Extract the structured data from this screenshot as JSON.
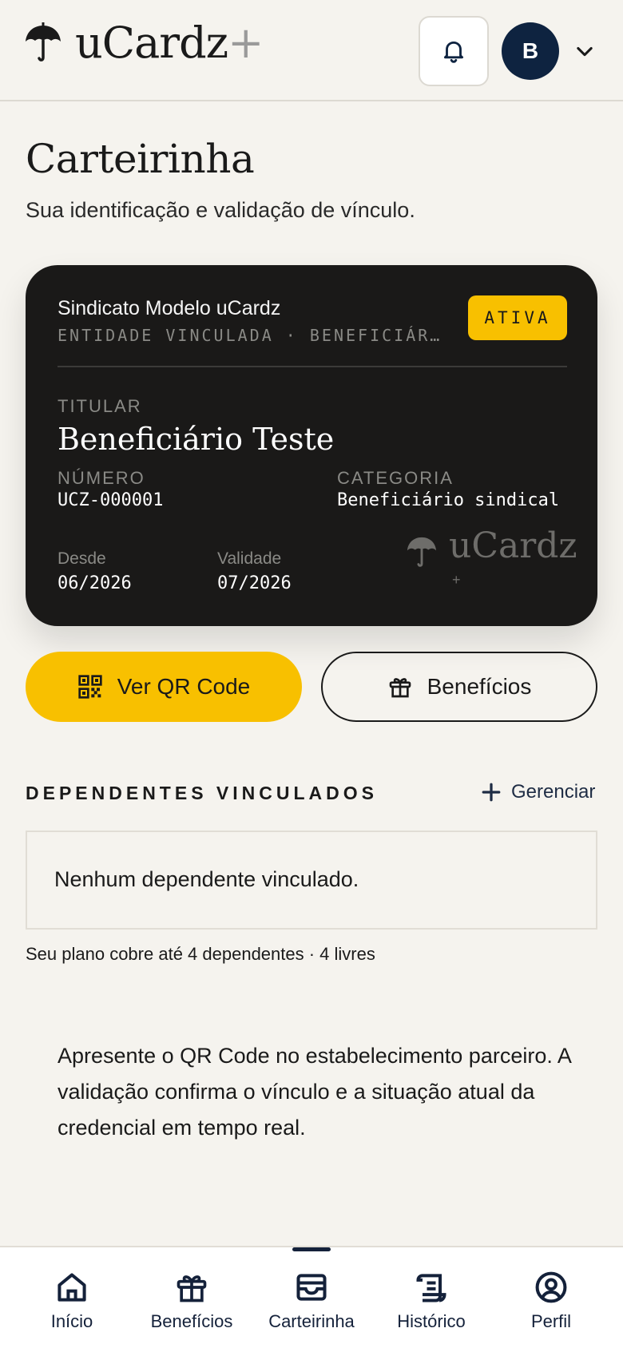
{
  "header": {
    "logo_text": "uCardz",
    "logo_plus": "+",
    "avatar_initial": "B"
  },
  "page": {
    "title": "Carteirinha",
    "subtitle": "Sua identificação e validação de vínculo."
  },
  "card": {
    "entity": "Sindicato Modelo uCardz",
    "entity_sub": "ENTIDADE VINCULADA · BENEFICIÁRIO",
    "badge": "ATIVA",
    "holder_label": "TITULAR",
    "holder_name": "Beneficiário Teste",
    "number_label": "NÚMERO",
    "number": "UCZ-000001",
    "category_label": "CATEGORIA",
    "category": "Beneficiário sindical",
    "since_label": "Desde",
    "since": "06/2026",
    "valid_label": "Validade",
    "valid": "07/2026",
    "brand": "uCardz",
    "brand_plus": "+"
  },
  "actions": {
    "qr_label": "Ver QR Code",
    "benefits_label": "Benefícios"
  },
  "dependents": {
    "title": "DEPENDENTES VINCULADOS",
    "manage_label": "Gerenciar",
    "empty_text": "Nenhum dependente vinculado.",
    "note": "Seu plano cobre até 4 dependentes · 4 livres"
  },
  "info": {
    "text": "Apresente o QR Code no estabelecimento parceiro. A validação confirma o vínculo e a situação atual da credencial em tempo real."
  },
  "nav": {
    "items": [
      {
        "label": "Início",
        "icon": "home-icon"
      },
      {
        "label": "Benefícios",
        "icon": "gift-icon"
      },
      {
        "label": "Carteirinha",
        "icon": "card-icon"
      },
      {
        "label": "Histórico",
        "icon": "scroll-icon"
      },
      {
        "label": "Perfil",
        "icon": "user-icon"
      }
    ],
    "active": "Carteirinha"
  },
  "colors": {
    "accent": "#f8c000",
    "navy": "#0e2340",
    "card_bg": "#1a1918",
    "page_bg": "#f5f3ee"
  }
}
